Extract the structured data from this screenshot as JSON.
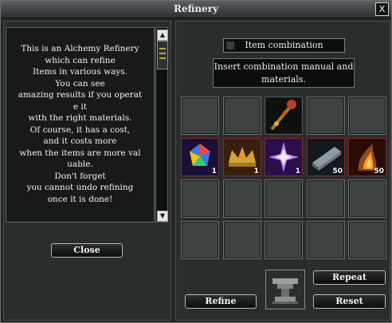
{
  "window": {
    "title": "Refinery",
    "close_label": "X"
  },
  "description": {
    "text": "This is an Alchemy Refinery\nwhich can refine\nItems in various ways.\nYou can see\namazing results if you operat\ne it\nwith the right materials.\nOf course, it has a cost,\nand it costs more\nwhen the items are more val\nuable.\nDon't forget\nyou cannot undo refining\nonce it is done!"
  },
  "scroll": {
    "up_icon": "triangle-up-icon",
    "down_icon": "triangle-down-icon"
  },
  "left_buttons": {
    "close_label": "Close"
  },
  "combination": {
    "title": "Item combination",
    "instruction": "Insert combination manual and materials."
  },
  "grid": {
    "rows": [
      [
        {
          "icon": ""
        },
        {
          "icon": ""
        },
        {
          "icon": "ornate-staff-icon"
        },
        {
          "icon": ""
        },
        {
          "icon": ""
        }
      ],
      [
        {
          "icon": "rainbow-crystal-icon",
          "count": "1"
        },
        {
          "icon": "golden-crown-icon",
          "count": "1"
        },
        {
          "icon": "purple-star-crystal-icon",
          "count": "1"
        },
        {
          "icon": "metal-ingot-icon",
          "count": "50"
        },
        {
          "icon": "fire-horn-icon",
          "count": "50"
        }
      ],
      [
        {
          "icon": ""
        },
        {
          "icon": ""
        },
        {
          "icon": ""
        },
        {
          "icon": ""
        },
        {
          "icon": ""
        }
      ],
      [
        {
          "icon": ""
        },
        {
          "icon": ""
        },
        {
          "icon": ""
        },
        {
          "icon": ""
        },
        {
          "icon": ""
        }
      ]
    ]
  },
  "actions": {
    "repeat_label": "Repeat",
    "refine_label": "Refine",
    "reset_label": "Reset",
    "anvil_icon": "anvil-icon"
  }
}
